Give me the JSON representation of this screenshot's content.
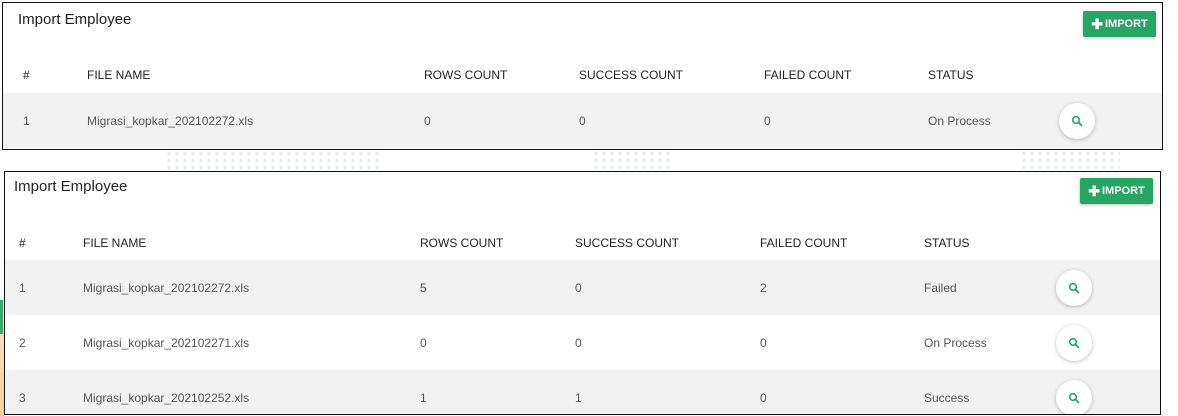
{
  "panel_top": {
    "title": "Import Employee",
    "import_label": "IMPORT",
    "columns": [
      "#",
      "FILE NAME",
      "ROWS COUNT",
      "SUCCESS COUNT",
      "FAILED COUNT",
      "STATUS"
    ],
    "rows": [
      {
        "num": "1",
        "file": "Migrasi_kopkar_202102272.xls",
        "rows_count": "0",
        "success": "0",
        "failed": "0",
        "status": "On Process"
      }
    ]
  },
  "panel_bottom": {
    "title": "Import Employee",
    "import_label": "IMPORT",
    "columns": [
      "#",
      "FILE NAME",
      "ROWS COUNT",
      "SUCCESS COUNT",
      "FAILED COUNT",
      "STATUS"
    ],
    "rows": [
      {
        "num": "1",
        "file": "Migrasi_kopkar_202102272.xls",
        "rows_count": "5",
        "success": "0",
        "failed": "2",
        "status": "Failed"
      },
      {
        "num": "2",
        "file": "Migrasi_kopkar_202102271.xls",
        "rows_count": "0",
        "success": "0",
        "failed": "0",
        "status": "On Process"
      },
      {
        "num": "3",
        "file": "Migrasi_kopkar_202102252.xls",
        "rows_count": "1",
        "success": "1",
        "failed": "0",
        "status": "Success"
      }
    ]
  },
  "colors": {
    "accent": "#27a563",
    "row_shade": "#f2f2f2"
  },
  "icons": {
    "import": "plus-icon",
    "view": "search-icon"
  }
}
